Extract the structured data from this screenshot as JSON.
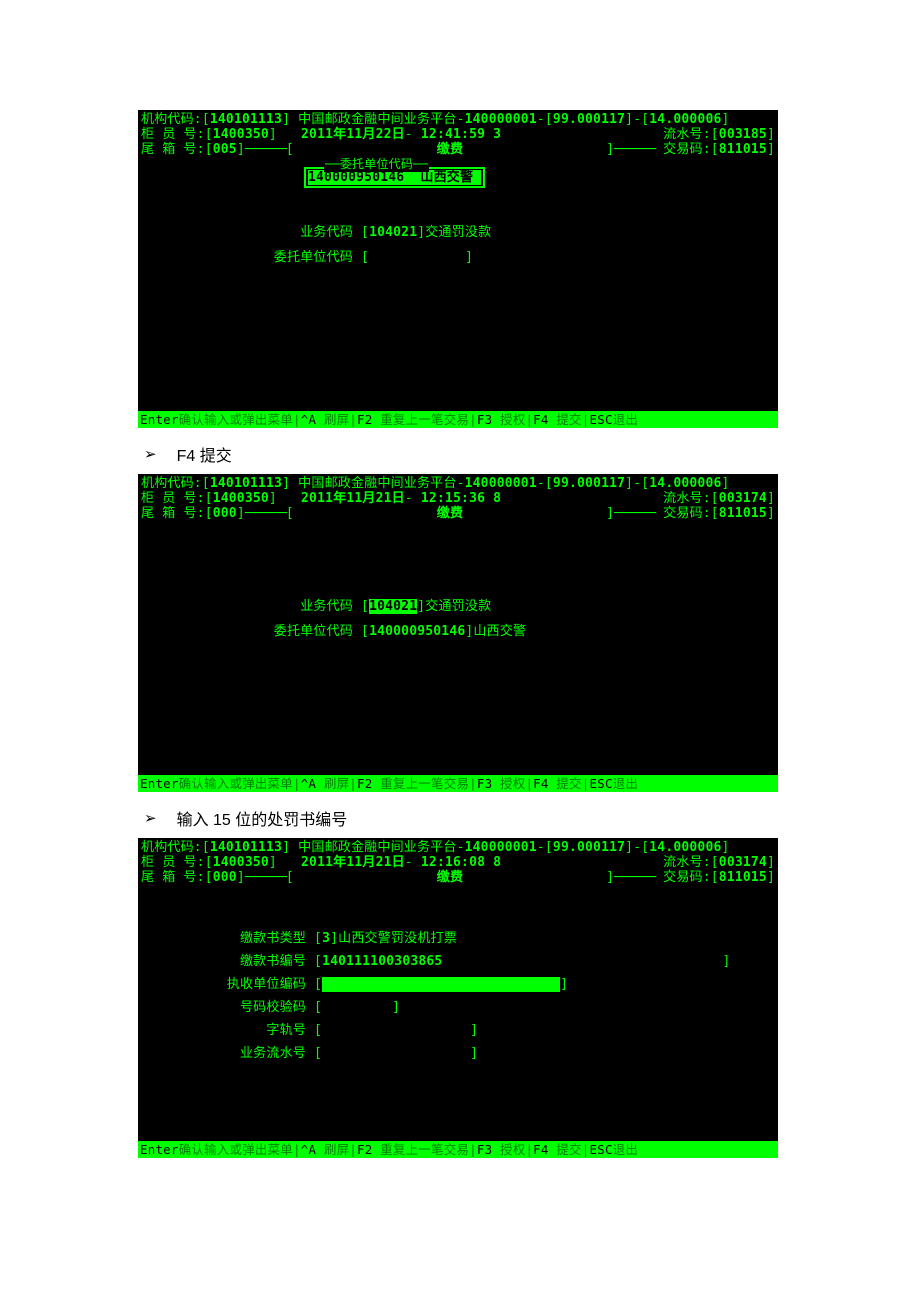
{
  "caption1": "F4 提交",
  "caption2": "输入 15 位的处罚书编号",
  "footer": {
    "enter_k": "Enter",
    "enter_t": "确认输入或弹出菜单",
    "a_k": "^A",
    "a_t": "刷屏",
    "f2_k": "F2",
    "f2_t": "重复上一笔交易",
    "f3_k": "F3",
    "f3_t": "授权",
    "f4_k": "F4",
    "f4_t": "提交",
    "esc_k": "ESC",
    "esc_t": "退出"
  },
  "labels": {
    "org_code": "机构代码:",
    "teller": "柜 员 号:",
    "tail": "尾 箱 号:",
    "flow": "流水号:",
    "txn": "交易码:",
    "title_prefix": "中国邮政金融中间业务平台-",
    "screen_title": "缴费",
    "biz_code": "业务代码",
    "entrust_code": "委托单位代码",
    "popup_title": "委托单位代码",
    "book_type": "缴款书类型",
    "book_no": "缴款书编号",
    "receive_unit": "执收单位编码",
    "check_code": "号码校验码",
    "track_no": "字轨号",
    "biz_flow": "业务流水号"
  },
  "s1": {
    "org_code": "140101113",
    "sys1": "140000001",
    "sys2": "99.000117",
    "sys3": "14.000006",
    "teller": "1400350",
    "date": "2011年11月22日",
    "time": "12:41:59",
    "seq": "3",
    "flow": "003185",
    "tail": "005",
    "txn": "811015",
    "biz_code": "104021",
    "biz_name": "交通罚没款",
    "entrust_code": "",
    "popup_code": "140000950146",
    "popup_name": "山西交警"
  },
  "s2": {
    "org_code": "140101113",
    "sys1": "140000001",
    "sys2": "99.000117",
    "sys3": "14.000006",
    "teller": "1400350",
    "date": "2011年11月21日",
    "time": "12:15:36",
    "seq": "8",
    "flow": "003174",
    "tail": "000",
    "txn": "811015",
    "biz_code": "104021",
    "biz_name": "交通罚没款",
    "entrust_code": "140000950146",
    "entrust_name": "山西交警"
  },
  "s3": {
    "org_code": "140101113",
    "sys1": "140000001",
    "sys2": "99.000117",
    "sys3": "14.000006",
    "teller": "1400350",
    "date": "2011年11月21日",
    "time": "12:16:08",
    "seq": "8",
    "flow": "003174",
    "tail": "000",
    "txn": "811015",
    "book_type_code": "3",
    "book_type_name": "山西交警罚没机打票",
    "book_no": "140111100303865",
    "receive_unit": "",
    "check_code": "",
    "track_no": "",
    "biz_flow": ""
  }
}
